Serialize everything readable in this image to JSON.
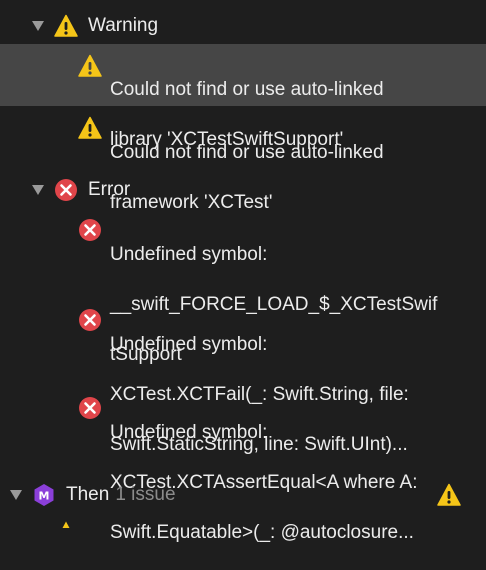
{
  "issue_navigator": {
    "warning_group": {
      "label": "Warning",
      "items": [
        {
          "lines": [
            "Could not find or use auto-linked",
            "library 'XCTestSwiftSupport'"
          ]
        },
        {
          "lines": [
            "Could not find or use auto-linked",
            "framework 'XCTest'"
          ]
        }
      ]
    },
    "error_group": {
      "label": "Error",
      "items": [
        {
          "lines": [
            "Undefined symbol:",
            "__swift_FORCE_LOAD_$_XCTestSwif",
            "tSupport"
          ]
        },
        {
          "lines": [
            "Undefined symbol:",
            "XCTest.XCTFail(_: Swift.String, file:",
            "Swift.StaticString, line: Swift.UInt)..."
          ]
        },
        {
          "lines": [
            "Undefined symbol:",
            "XCTest.XCTAssertEqual<A where A:",
            "Swift.Equatable>(_: @autoclosure..."
          ]
        }
      ]
    },
    "target_group": {
      "badge": "M",
      "name": "Then",
      "count_text": "1 issue"
    }
  },
  "colors": {
    "background": "#1e1e1e",
    "selected_row": "#464646",
    "warning_yellow": "#f5c518",
    "error_red": "#e0454a",
    "target_purple": "#8b3fd9",
    "secondary_text": "#8c8c8c"
  },
  "icons": {
    "warning": "warning-triangle-icon",
    "error": "error-x-icon",
    "target": "target-module-icon",
    "disclosure": "disclosure-triangle-icon"
  }
}
